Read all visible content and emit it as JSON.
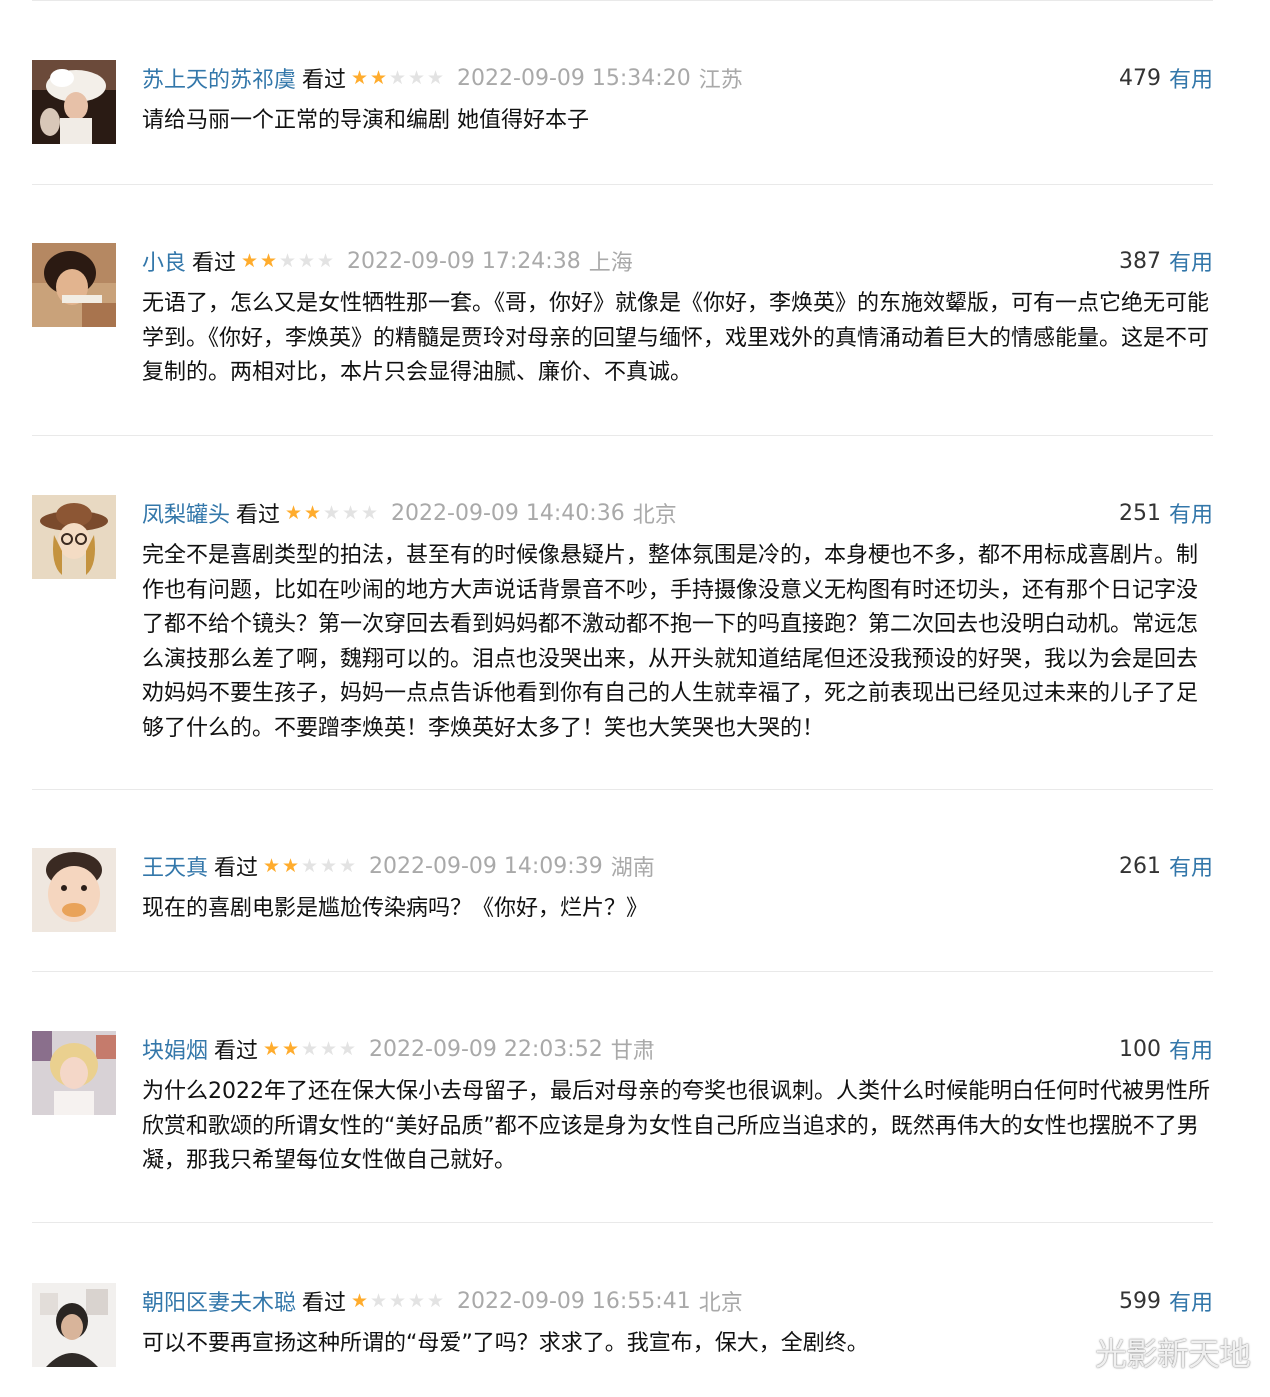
{
  "watched_label": "看过",
  "useful_label": "有用",
  "colors": {
    "link": "#3377aa",
    "star_on": "#ffac2d",
    "star_off": "#e3e3e3",
    "meta_gray": "#a9a9a9"
  },
  "comments": [
    {
      "username": "苏上天的苏祁虞",
      "rating": 2,
      "time": "2022-09-09 15:34:20",
      "location": "江苏",
      "votes": "479",
      "text": "请给马丽一个正常的导演和编剧 她值得好本子",
      "avatar_icon": "avatar-vintage-hat-woman"
    },
    {
      "username": "小良",
      "rating": 2,
      "time": "2022-09-09 17:24:38",
      "location": "上海",
      "votes": "387",
      "text": "无语了，怎么又是女性牺牲那一套。《哥，你好》就像是《你好，李焕英》的东施效颦版，可有一点它绝无可能学到。《你好，李焕英》的精髓是贾玲对母亲的回望与缅怀，戏里戏外的真情涌动着巨大的情感能量。这是不可复制的。两相对比，本片只会显得油腻、廉价、不真诚。",
      "avatar_icon": "avatar-retro-photo"
    },
    {
      "username": "凤梨罐头",
      "rating": 2,
      "time": "2022-09-09 14:40:36",
      "location": "北京",
      "votes": "251",
      "text": "完全不是喜剧类型的拍法，甚至有的时候像悬疑片，整体氛围是冷的，本身梗也不多，都不用标成喜剧片。制作也有问题，比如在吵闹的地方大声说话背景音不吵，手持摄像没意义无构图有时还切头，还有那个日记字没了都不给个镜头？第一次穿回去看到妈妈都不激动都不抱一下的吗直接跑？第二次回去也没明白动机。常远怎么演技那么差了啊，魏翔可以的。泪点也没哭出来，从开头就知道结尾但还没我预设的好哭，我以为会是回去劝妈妈不要生孩子，妈妈一点点告诉他看到你有自己的人生就幸福了，死之前表现出已经见过未来的儿子了足够了什么的。不要蹭李焕英！李焕英好太多了！笑也大笑哭也大哭的！",
      "avatar_icon": "avatar-illustrated-girl-hat"
    },
    {
      "username": "王天真",
      "rating": 2,
      "time": "2022-09-09 14:09:39",
      "location": "湖南",
      "votes": "261",
      "text": "现在的喜剧电影是尴尬传染病吗？《你好，烂片？》",
      "avatar_icon": "avatar-toddler"
    },
    {
      "username": "块娟烟",
      "rating": 2,
      "time": "2022-09-09 22:03:52",
      "location": "甘肃",
      "votes": "100",
      "text": "为什么2022年了还在保大保小去母留子，最后对母亲的夸奖也很讽刺。人类什么时候能明白任何时代被男性所欣赏和歌颂的所谓女性的“美好品质”都不应该是身为女性自己所应当追求的，既然再伟大的女性也摆脱不了男凝，那我只希望每位女性做自己就好。",
      "avatar_icon": "avatar-blonde-girl"
    },
    {
      "username": "朝阳区妻夫木聪",
      "rating": 1,
      "time": "2022-09-09 16:55:41",
      "location": "北京",
      "votes": "599",
      "text": "可以不要再宣扬这种所谓的“母爱”了吗？求求了。我宣布，保大，全剧终。",
      "avatar_icon": "avatar-man-portrait"
    }
  ],
  "watermark": "光影新天地"
}
